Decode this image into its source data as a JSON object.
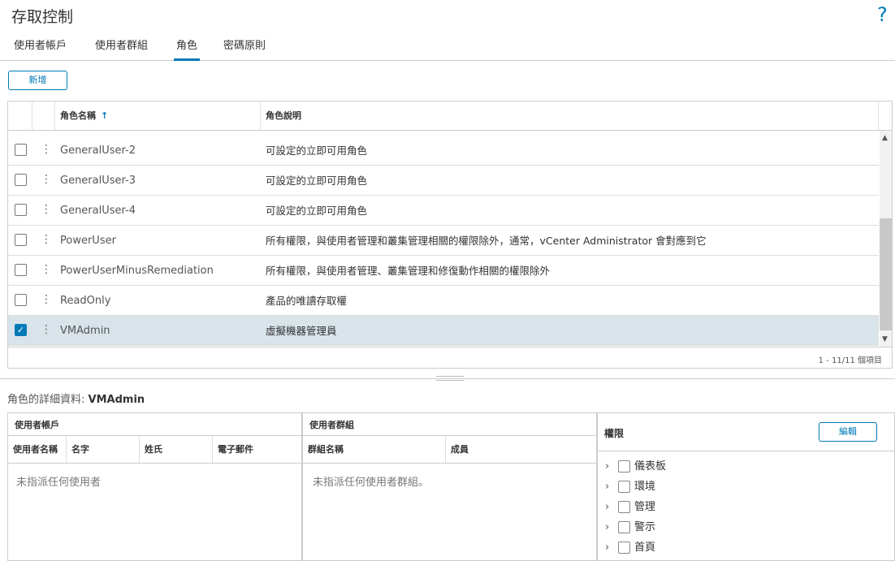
{
  "page": {
    "title": "存取控制",
    "help": "?"
  },
  "tabs": [
    {
      "label": "使用者帳戶"
    },
    {
      "label": "使用者群組"
    },
    {
      "label": "角色"
    },
    {
      "label": "密碼原則"
    }
  ],
  "toolbar": {
    "add_label": "新增"
  },
  "grid": {
    "columns": {
      "name": "角色名稱",
      "description": "角色說明",
      "sort_icon": "↑"
    },
    "rows": [
      {
        "name": "GeneralUser-2",
        "description": "可設定的立即可用角色",
        "checked": false
      },
      {
        "name": "GeneralUser-3",
        "description": "可設定的立即可用角色",
        "checked": false
      },
      {
        "name": "GeneralUser-4",
        "description": "可設定的立即可用角色",
        "checked": false
      },
      {
        "name": "PowerUser",
        "description": "所有權限，與使用者管理和叢集管理相關的權限除外，通常，vCenter Administrator 會對應到它",
        "checked": false
      },
      {
        "name": "PowerUserMinusRemediation",
        "description": "所有權限，與使用者管理、叢集管理和修復動作相關的權限除外",
        "checked": false
      },
      {
        "name": "ReadOnly",
        "description": "產品的唯讀存取權",
        "checked": false
      },
      {
        "name": "VMAdmin",
        "description": "虛擬機器管理員",
        "checked": true
      }
    ],
    "pager": "1 - 11/11 個項目"
  },
  "details": {
    "label": "角色的詳細資料:",
    "role": "VMAdmin",
    "users": {
      "title": "使用者帳戶",
      "columns": [
        "使用者名稱",
        "名字",
        "姓氏",
        "電子郵件"
      ],
      "empty": "未指派任何使用者"
    },
    "groups": {
      "title": "使用者群組",
      "columns": [
        "群組名稱",
        "成員"
      ],
      "empty": "未指派任何使用者群組。"
    },
    "permissions": {
      "title": "權限",
      "edit_label": "編輯",
      "items": [
        "儀表板",
        "環境",
        "管理",
        "警示",
        "首頁"
      ]
    }
  },
  "colors": {
    "accent": "#0079b8",
    "selected_row": "#d9e4ea"
  }
}
